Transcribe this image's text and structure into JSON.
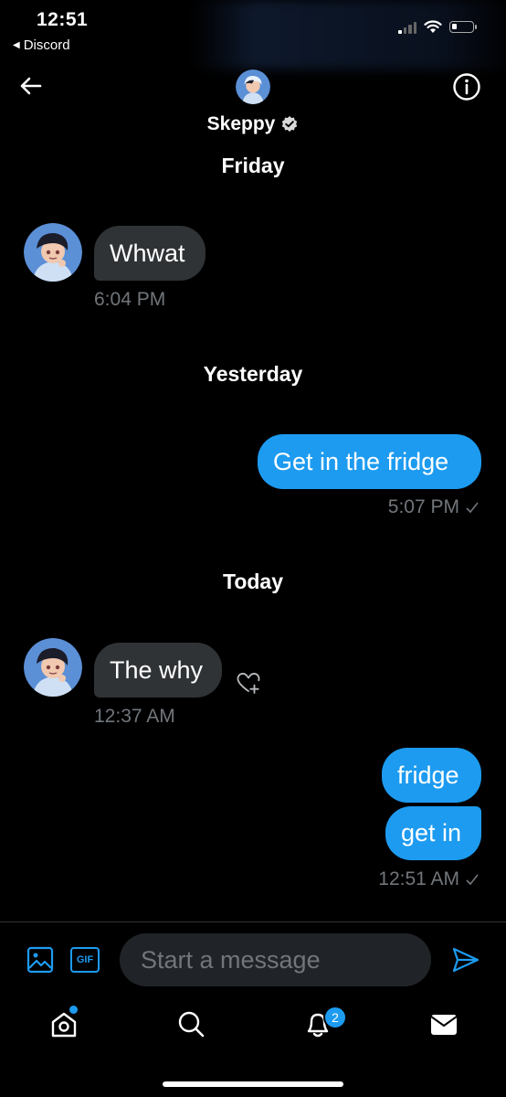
{
  "status_bar": {
    "time": "12:51",
    "back_app": "Discord"
  },
  "header": {
    "name": "Skeppy",
    "verified": true
  },
  "conversation": {
    "days": [
      "Friday",
      "Yesterday",
      "Today"
    ],
    "messages": [
      {
        "direction": "incoming",
        "text": "Whwat",
        "time": "6:04 PM"
      },
      {
        "direction": "outgoing",
        "text": "Get in the fridge",
        "time": "5:07 PM"
      },
      {
        "direction": "incoming",
        "text": "The why",
        "time": "12:37 AM"
      },
      {
        "direction": "outgoing",
        "text": "fridge",
        "time": ""
      },
      {
        "direction": "outgoing",
        "text": "get in",
        "time": "12:51 AM"
      }
    ]
  },
  "composer": {
    "placeholder": "Start a message",
    "gif_label": "GIF"
  },
  "tab_bar": {
    "notifications_badge": "2",
    "icons": [
      "home-icon",
      "search-icon",
      "bell-icon",
      "mail-icon"
    ]
  },
  "colors": {
    "accent": "#1d9bf0",
    "bubble_in": "#2f3336",
    "meta_text": "#71767b",
    "background": "#000000"
  }
}
